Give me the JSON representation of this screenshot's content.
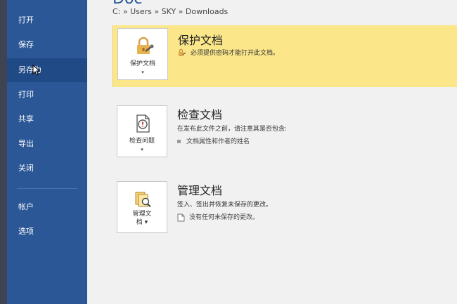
{
  "sidebar": {
    "items": [
      {
        "label": "打开"
      },
      {
        "label": "保存"
      },
      {
        "label": "另存为"
      },
      {
        "label": "打印"
      },
      {
        "label": "共享"
      },
      {
        "label": "导出"
      },
      {
        "label": "关闭"
      },
      {
        "label": "帐户"
      },
      {
        "label": "选项"
      }
    ],
    "active_index": 2
  },
  "main": {
    "title_partial": "Doc",
    "breadcrumb": "C: » Users » SKY » Downloads",
    "sections": [
      {
        "title": "保护文档",
        "tile_label": "保护文档",
        "tile_caret": "▾",
        "line1": "必须提供密码才能打开此文档。",
        "icon": "lock-key-icon"
      },
      {
        "title": "检查文档",
        "tile_label": "检查问题",
        "tile_caret": "▾",
        "line1": "在发布此文件之前，请注意其是否包含:",
        "line2": "文档属性和作者的姓名",
        "icon": "inspect-document-icon"
      },
      {
        "title": "管理文档",
        "tile_label_line1": "管理文",
        "tile_label_line2": "档 ▾",
        "line1": "签入、签出并恢复未保存的更改。",
        "line2": "没有任何未保存的更改。",
        "icon": "manage-document-icon"
      }
    ]
  },
  "colors": {
    "sidebar": "#2b5797",
    "highlight": "#fbe78a",
    "background": "#f1f1f1"
  }
}
